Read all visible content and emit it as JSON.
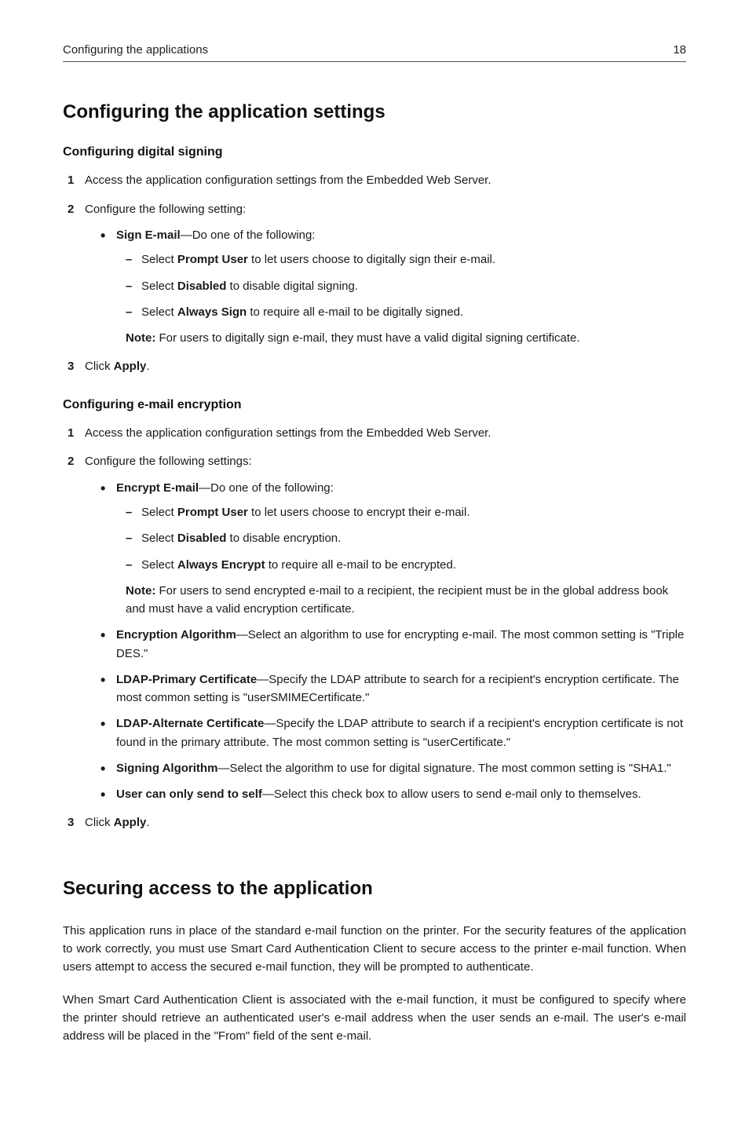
{
  "header": {
    "left": "Configuring the applications",
    "right": "18"
  },
  "section1": {
    "title": "Configuring the application settings",
    "sub1": {
      "title": "Configuring digital signing",
      "step1": "Access the application configuration settings from the Embedded Web Server.",
      "step2_lead": "Configure the following setting:",
      "bullet1_b": "Sign E‑mail",
      "bullet1_rest": "—Do one of the following:",
      "dash1_pre": "Select ",
      "dash1_b": "Prompt User",
      "dash1_post": " to let users choose to digitally sign their e‑mail.",
      "dash2_pre": "Select ",
      "dash2_b": "Disabled",
      "dash2_post": " to disable digital signing.",
      "dash3_pre": "Select ",
      "dash3_b": "Always Sign",
      "dash3_post": " to require all e‑mail to be digitally signed.",
      "note_b": "Note:",
      "note_rest": " For users to digitally sign e‑mail, they must have a valid digital signing certificate.",
      "step3_pre": "Click ",
      "step3_b": "Apply",
      "step3_post": "."
    },
    "sub2": {
      "title": "Configuring e‑mail encryption",
      "step1": "Access the application configuration settings from the Embedded Web Server.",
      "step2_lead": "Configure the following settings:",
      "b1_b": "Encrypt E‑mail",
      "b1_rest": "—Do one of the following:",
      "d1_pre": "Select ",
      "d1_b": "Prompt User",
      "d1_post": " to let users choose to encrypt their e‑mail.",
      "d2_pre": "Select ",
      "d2_b": "Disabled",
      "d2_post": " to disable encryption.",
      "d3_pre": "Select ",
      "d3_b": "Always Encrypt",
      "d3_post": " to require all e‑mail to be encrypted.",
      "note_b": "Note:",
      "note_rest": " For users to send encrypted e‑mail to a recipient, the recipient must be in the global address book and must have a valid encryption certificate.",
      "b2_b": "Encryption Algorithm",
      "b2_rest": "—Select an algorithm to use for encrypting e‑mail. The most common setting is \"Triple DES.\"",
      "b3_b": "LDAP‑Primary Certificate",
      "b3_rest": "—Specify the LDAP attribute to search for a recipient's encryption certificate. The most common setting is \"userSMIMECertificate.\"",
      "b4_b": "LDAP‑Alternate Certificate",
      "b4_rest": "—Specify the LDAP attribute to search if a recipient's encryption certificate is not found in the primary attribute. The most common setting is \"userCertificate.\"",
      "b5_b": "Signing Algorithm",
      "b5_rest": "—Select the algorithm to use for digital signature. The most common setting is \"SHA1.\"",
      "b6_b": "User can only send to self",
      "b6_rest": "—Select this check box to allow users to send e‑mail only to themselves.",
      "step3_pre": "Click ",
      "step3_b": "Apply",
      "step3_post": "."
    }
  },
  "section2": {
    "title": "Securing access to the application",
    "p1": "This application runs in place of the standard e‑mail function on the printer. For the security features of the application to work correctly, you must use Smart Card Authentication Client to secure access to the printer e‑mail function. When users attempt to access the secured e‑mail function, they will be prompted to authenticate.",
    "p2": "When Smart Card Authentication Client is associated with the e‑mail function, it must be configured to specify where the printer should retrieve an authenticated user's e‑mail address when the user sends an e‑mail. The user's e‑mail address will be placed in the \"From\" field of the sent e‑mail."
  }
}
